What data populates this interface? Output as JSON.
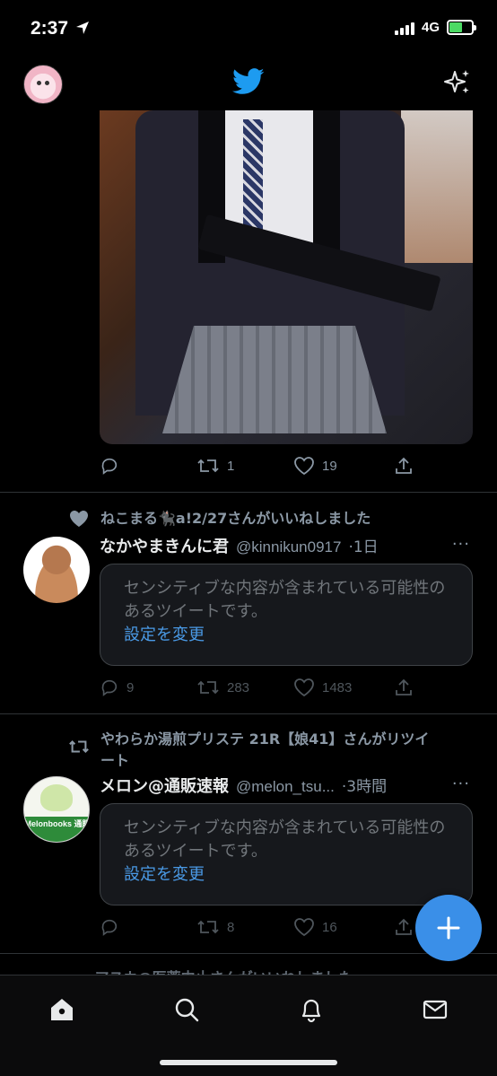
{
  "status_bar": {
    "time": "2:37",
    "network": "4G",
    "icons": [
      "location-arrow-icon",
      "signal-icon",
      "battery-charging-icon"
    ]
  },
  "header": {
    "logo": "twitter-bird-icon",
    "sparkle": "sparkle-icon",
    "avatar": "profile-avatar"
  },
  "timeline": [
    {
      "id": "tweet-1",
      "media": "photo",
      "stats": {
        "replies": "",
        "retweets": "1",
        "likes": "19"
      }
    },
    {
      "id": "tweet-2",
      "context": "ねこまる🐈‍⬛a!2/27さんがいいねしました",
      "author": {
        "name": "なかやまきんに君",
        "handle": "@kinnikun0917",
        "time": "·1日"
      },
      "sensitive": {
        "message": "センシティブな内容が含まれている可能性のあるツイートです。",
        "link": "設定を変更"
      },
      "stats": {
        "replies": "9",
        "retweets": "283",
        "likes": "1483"
      }
    },
    {
      "id": "tweet-3",
      "context": "やわらか湯煎プリステ 21R【娘41】さんがリツイート",
      "author": {
        "name": "メロン@通販速報",
        "handle": "@melon_tsu...",
        "time": "·3時間"
      },
      "avatar_text": "Melonbooks 通販",
      "sensitive": {
        "message": "センシティブな内容が含まれている可能性のあるツイートです。",
        "link": "設定を変更"
      },
      "stats": {
        "replies": "",
        "retweets": "8",
        "likes": "16"
      }
    }
  ],
  "peek_text": "アスカ@医薬中止さんがいいねしました",
  "more_glyph": "···",
  "fab": {
    "icon": "plus-icon",
    "label": "+"
  },
  "bottom_nav": [
    {
      "name": "home",
      "icon": "home-icon"
    },
    {
      "name": "search",
      "icon": "search-icon"
    },
    {
      "name": "notifications",
      "icon": "bell-icon"
    },
    {
      "name": "messages",
      "icon": "mail-icon"
    }
  ],
  "colors": {
    "background": "#000000",
    "accent": "#1d9bf0",
    "muted": "#8b98a5",
    "link": "#4a9ae6"
  }
}
